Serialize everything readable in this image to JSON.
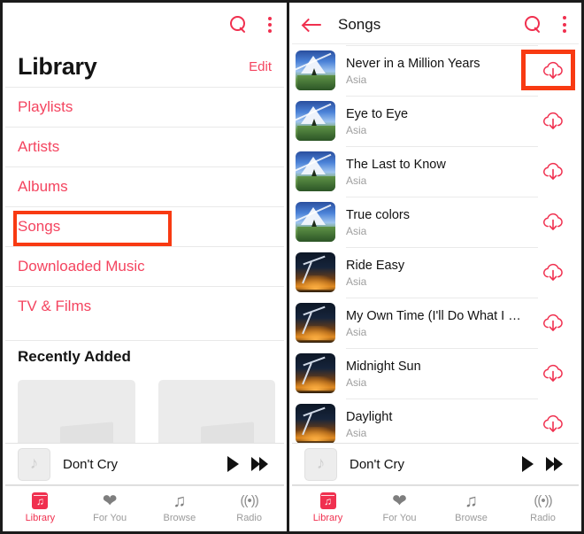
{
  "left_panel": {
    "topbar": {
      "search_icon": "search-icon",
      "overflow_icon": "more-vertical-icon"
    },
    "title": "Library",
    "edit_label": "Edit",
    "library_items": [
      {
        "label": "Playlists",
        "highlighted": false
      },
      {
        "label": "Artists",
        "highlighted": false
      },
      {
        "label": "Albums",
        "highlighted": false
      },
      {
        "label": "Songs",
        "highlighted": true
      },
      {
        "label": "Downloaded Music",
        "highlighted": false
      },
      {
        "label": "TV & Films",
        "highlighted": false
      }
    ],
    "section_header": "Recently Added",
    "recently_added": [
      {
        "label": ""
      },
      {
        "label": ""
      }
    ]
  },
  "right_panel": {
    "topbar": {
      "back_icon": "back-arrow-icon",
      "title": "Songs",
      "search_icon": "search-icon",
      "overflow_icon": "more-vertical-icon"
    },
    "songs": [
      {
        "name": "Never in a Million Years",
        "artist": "Asia",
        "art": "art-mountain",
        "download_icon": "cloud-download-icon",
        "highlighted": true
      },
      {
        "name": "Eye to Eye",
        "artist": "Asia",
        "art": "art-mountain",
        "download_icon": "cloud-download-icon",
        "highlighted": false
      },
      {
        "name": "The Last to Know",
        "artist": "Asia",
        "art": "art-mountain",
        "download_icon": "cloud-download-icon",
        "highlighted": false
      },
      {
        "name": "True colors",
        "artist": "Asia",
        "art": "art-mountain",
        "download_icon": "cloud-download-icon",
        "highlighted": false
      },
      {
        "name": "Ride Easy",
        "artist": "Asia",
        "art": "art-night",
        "download_icon": "cloud-download-icon",
        "highlighted": false
      },
      {
        "name": "My Own Time (I'll Do What I …",
        "artist": "Asia",
        "art": "art-night",
        "download_icon": "cloud-download-icon",
        "highlighted": false
      },
      {
        "name": "Midnight Sun",
        "artist": "Asia",
        "art": "art-night",
        "download_icon": "cloud-download-icon",
        "highlighted": false
      },
      {
        "name": "Daylight",
        "artist": "Asia",
        "art": "art-night",
        "download_icon": "cloud-download-icon",
        "highlighted": false
      }
    ]
  },
  "mini_player": {
    "artwork_icon": "music-note-icon",
    "track_title": "Don't Cry",
    "play_label": "play-button",
    "forward_label": "fast-forward-button"
  },
  "tabbar": {
    "tabs": [
      {
        "label": "Library",
        "icon": "library-icon",
        "active": true
      },
      {
        "label": "For You",
        "icon": "heart-icon",
        "active": false
      },
      {
        "label": "Browse",
        "icon": "music-note-icon",
        "active": false
      },
      {
        "label": "Radio",
        "icon": "radio-waves-icon",
        "active": false
      }
    ]
  },
  "colors": {
    "accent_pink": "#f4445f",
    "accent_red": "#f0304f",
    "highlight_box": "#f83a12",
    "text_dark": "#141414",
    "text_muted": "#9e9e9e",
    "divider": "#e9e9e9"
  }
}
